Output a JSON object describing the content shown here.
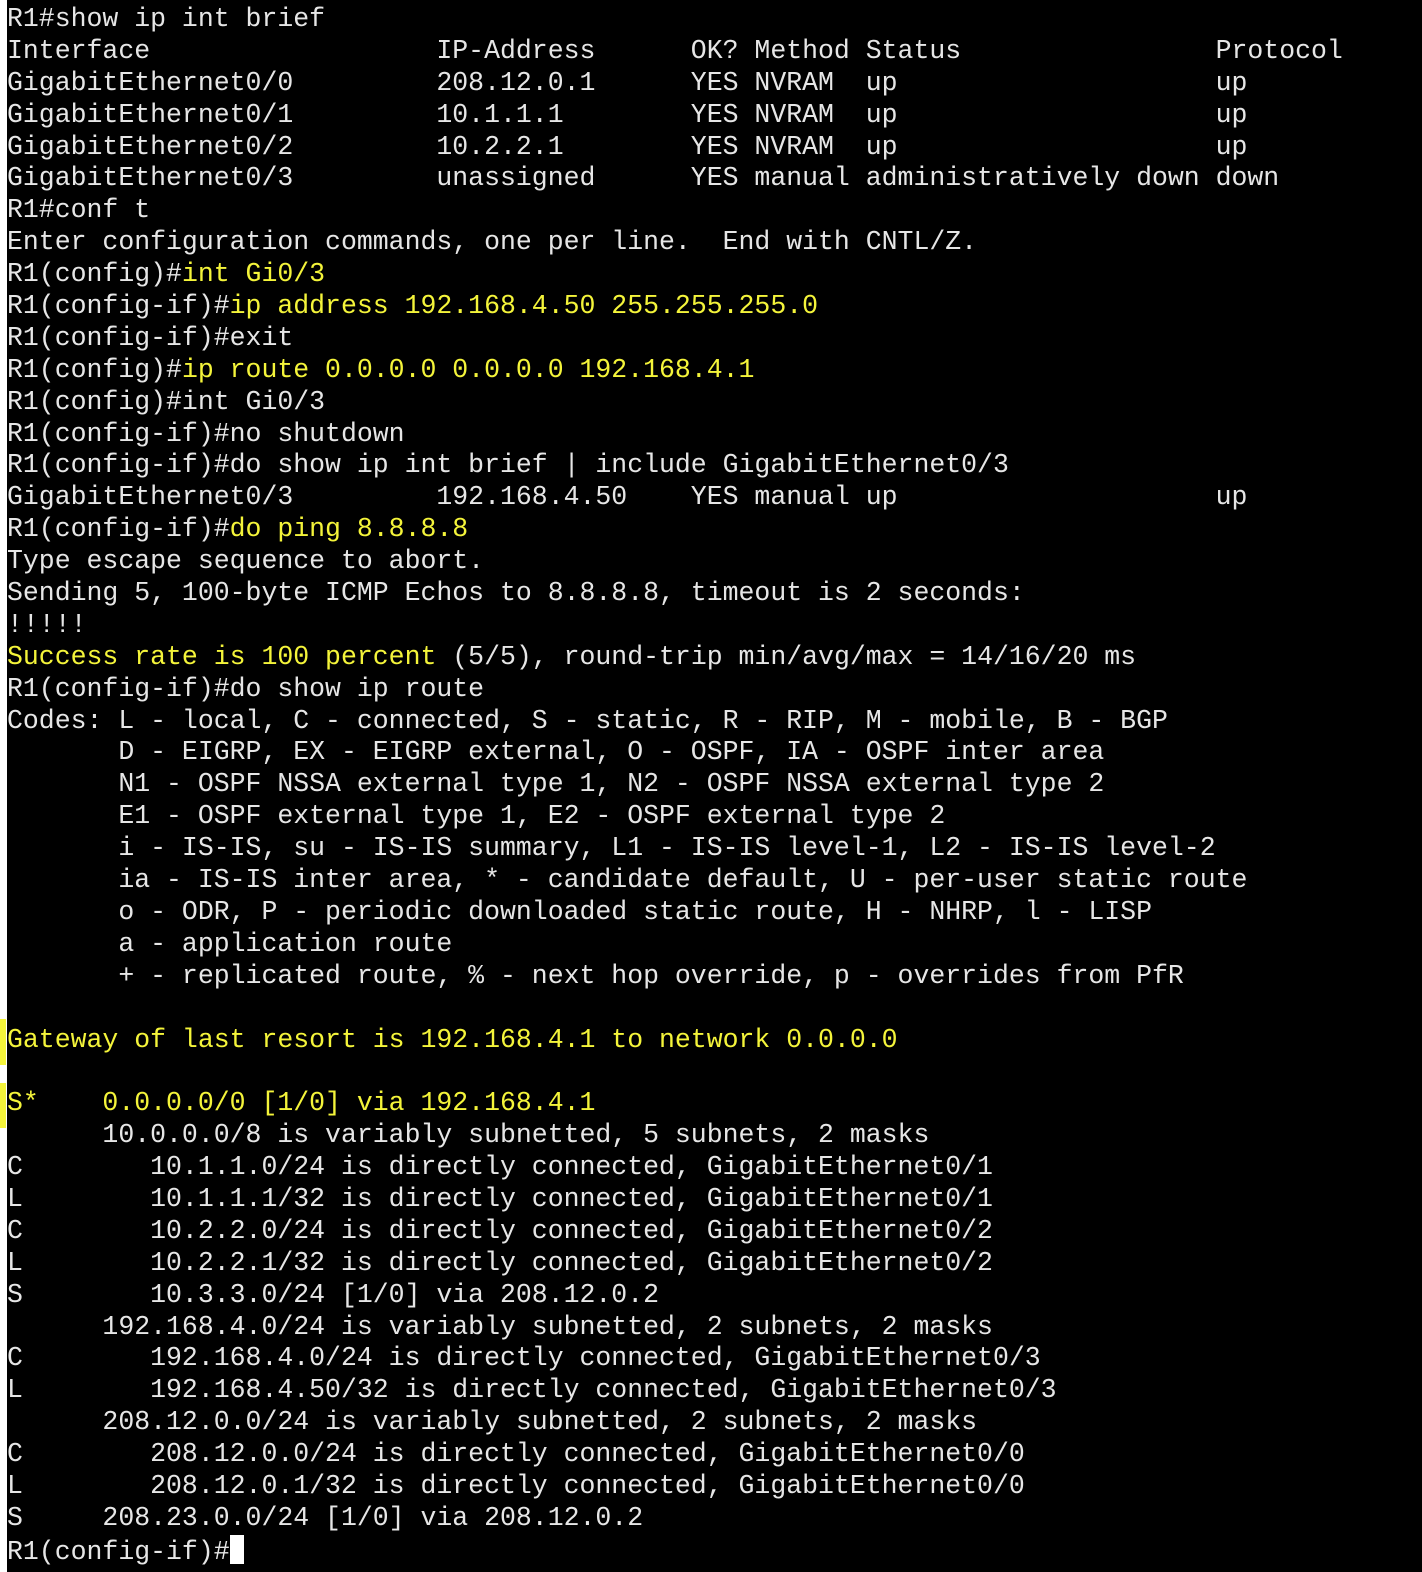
{
  "terminal": {
    "lines": [
      {
        "parts": [
          {
            "t": "R1#show ip int brief",
            "c": "n"
          }
        ]
      },
      {
        "parts": [
          {
            "t": "Interface                  IP-Address      OK? Method Status                Protocol",
            "c": "n"
          }
        ]
      },
      {
        "parts": [
          {
            "t": "GigabitEthernet0/0         208.12.0.1      YES NVRAM  up                    up",
            "c": "n"
          }
        ]
      },
      {
        "parts": [
          {
            "t": "GigabitEthernet0/1         10.1.1.1        YES NVRAM  up                    up",
            "c": "n"
          }
        ]
      },
      {
        "parts": [
          {
            "t": "GigabitEthernet0/2         10.2.2.1        YES NVRAM  up                    up",
            "c": "n"
          }
        ]
      },
      {
        "parts": [
          {
            "t": "GigabitEthernet0/3         unassigned      YES manual administratively down down",
            "c": "n"
          }
        ]
      },
      {
        "parts": [
          {
            "t": "R1#conf t",
            "c": "n"
          }
        ]
      },
      {
        "parts": [
          {
            "t": "Enter configuration commands, one per line.  End with CNTL/Z.",
            "c": "n"
          }
        ]
      },
      {
        "parts": [
          {
            "t": "R1(config)#",
            "c": "n"
          },
          {
            "t": "int Gi0/3",
            "c": "y"
          }
        ]
      },
      {
        "parts": [
          {
            "t": "R1(config-if)#",
            "c": "n"
          },
          {
            "t": "ip address 192.168.4.50 255.255.255.0",
            "c": "y"
          }
        ]
      },
      {
        "parts": [
          {
            "t": "R1(config-if)#exit",
            "c": "n"
          }
        ]
      },
      {
        "parts": [
          {
            "t": "R1(config)#",
            "c": "n"
          },
          {
            "t": "ip route 0.0.0.0 0.0.0.0 192.168.4.1",
            "c": "y"
          }
        ]
      },
      {
        "parts": [
          {
            "t": "R1(config)#int Gi0/3",
            "c": "n"
          }
        ]
      },
      {
        "parts": [
          {
            "t": "R1(config-if)#no shutdown",
            "c": "n"
          }
        ]
      },
      {
        "parts": [
          {
            "t": "R1(config-if)#do show ip int brief | include GigabitEthernet0/3",
            "c": "n"
          }
        ]
      },
      {
        "parts": [
          {
            "t": "GigabitEthernet0/3         192.168.4.50    YES manual up                    up",
            "c": "n"
          }
        ]
      },
      {
        "parts": [
          {
            "t": "R1(config-if)#",
            "c": "n"
          },
          {
            "t": "do ping 8.8.8.8",
            "c": "y"
          }
        ]
      },
      {
        "parts": [
          {
            "t": "Type escape sequence to abort.",
            "c": "n"
          }
        ]
      },
      {
        "parts": [
          {
            "t": "Sending 5, 100-byte ICMP Echos to 8.8.8.8, timeout is 2 seconds:",
            "c": "n"
          }
        ]
      },
      {
        "parts": [
          {
            "t": "!!!!!",
            "c": "n"
          }
        ]
      },
      {
        "parts": [
          {
            "t": "Success rate is 100 percent",
            "c": "y"
          },
          {
            "t": " (5/5), round-trip min/avg/max = 14/16/20 ms",
            "c": "n"
          }
        ]
      },
      {
        "parts": [
          {
            "t": "R1(config-if)#do show ip route",
            "c": "n"
          }
        ]
      },
      {
        "parts": [
          {
            "t": "Codes: L - local, C - connected, S - static, R - RIP, M - mobile, B - BGP",
            "c": "n"
          }
        ]
      },
      {
        "parts": [
          {
            "t": "       D - EIGRP, EX - EIGRP external, O - OSPF, IA - OSPF inter area",
            "c": "n"
          }
        ]
      },
      {
        "parts": [
          {
            "t": "       N1 - OSPF NSSA external type 1, N2 - OSPF NSSA external type 2",
            "c": "n"
          }
        ]
      },
      {
        "parts": [
          {
            "t": "       E1 - OSPF external type 1, E2 - OSPF external type 2",
            "c": "n"
          }
        ]
      },
      {
        "parts": [
          {
            "t": "       i - IS-IS, su - IS-IS summary, L1 - IS-IS level-1, L2 - IS-IS level-2",
            "c": "n"
          }
        ]
      },
      {
        "parts": [
          {
            "t": "       ia - IS-IS inter area, * - candidate default, U - per-user static route",
            "c": "n"
          }
        ]
      },
      {
        "parts": [
          {
            "t": "       o - ODR, P - periodic downloaded static route, H - NHRP, l - LISP",
            "c": "n"
          }
        ]
      },
      {
        "parts": [
          {
            "t": "       a - application route",
            "c": "n"
          }
        ]
      },
      {
        "parts": [
          {
            "t": "       + - replicated route, % - next hop override, p - overrides from PfR",
            "c": "n"
          }
        ]
      },
      {
        "parts": [
          {
            "t": "",
            "c": "n"
          }
        ]
      },
      {
        "parts": [
          {
            "t": "Gateway of last resort is 192.168.4.1 to network 0.0.0.0",
            "c": "y"
          }
        ],
        "marker": true
      },
      {
        "parts": [
          {
            "t": "",
            "c": "n"
          }
        ]
      },
      {
        "parts": [
          {
            "t": "S*    0.0.0.0/0 [1/0] via 192.168.4.1",
            "c": "y"
          }
        ],
        "marker": true
      },
      {
        "parts": [
          {
            "t": "      10.0.0.0/8 is variably subnetted, 5 subnets, 2 masks",
            "c": "n"
          }
        ]
      },
      {
        "parts": [
          {
            "t": "C        10.1.1.0/24 is directly connected, GigabitEthernet0/1",
            "c": "n"
          }
        ]
      },
      {
        "parts": [
          {
            "t": "L        10.1.1.1/32 is directly connected, GigabitEthernet0/1",
            "c": "n"
          }
        ]
      },
      {
        "parts": [
          {
            "t": "C        10.2.2.0/24 is directly connected, GigabitEthernet0/2",
            "c": "n"
          }
        ]
      },
      {
        "parts": [
          {
            "t": "L        10.2.2.1/32 is directly connected, GigabitEthernet0/2",
            "c": "n"
          }
        ]
      },
      {
        "parts": [
          {
            "t": "S        10.3.3.0/24 [1/0] via 208.12.0.2",
            "c": "n"
          }
        ]
      },
      {
        "parts": [
          {
            "t": "      192.168.4.0/24 is variably subnetted, 2 subnets, 2 masks",
            "c": "n"
          }
        ]
      },
      {
        "parts": [
          {
            "t": "C        192.168.4.0/24 is directly connected, GigabitEthernet0/3",
            "c": "n"
          }
        ]
      },
      {
        "parts": [
          {
            "t": "L        192.168.4.50/32 is directly connected, GigabitEthernet0/3",
            "c": "n"
          }
        ]
      },
      {
        "parts": [
          {
            "t": "      208.12.0.0/24 is variably subnetted, 2 subnets, 2 masks",
            "c": "n"
          }
        ]
      },
      {
        "parts": [
          {
            "t": "C        208.12.0.0/24 is directly connected, GigabitEthernet0/0",
            "c": "n"
          }
        ]
      },
      {
        "parts": [
          {
            "t": "L        208.12.0.1/32 is directly connected, GigabitEthernet0/0",
            "c": "n"
          }
        ]
      },
      {
        "parts": [
          {
            "t": "S     208.23.0.0/24 [1/0] via 208.12.0.2",
            "c": "n"
          }
        ]
      },
      {
        "parts": [
          {
            "t": "R1(config-if)#",
            "c": "n"
          }
        ],
        "cursor": true
      }
    ]
  },
  "colors": {
    "background": "#000000",
    "text": "#e6e6e6",
    "highlight": "#f4f43a",
    "cursor": "#ffffff"
  }
}
